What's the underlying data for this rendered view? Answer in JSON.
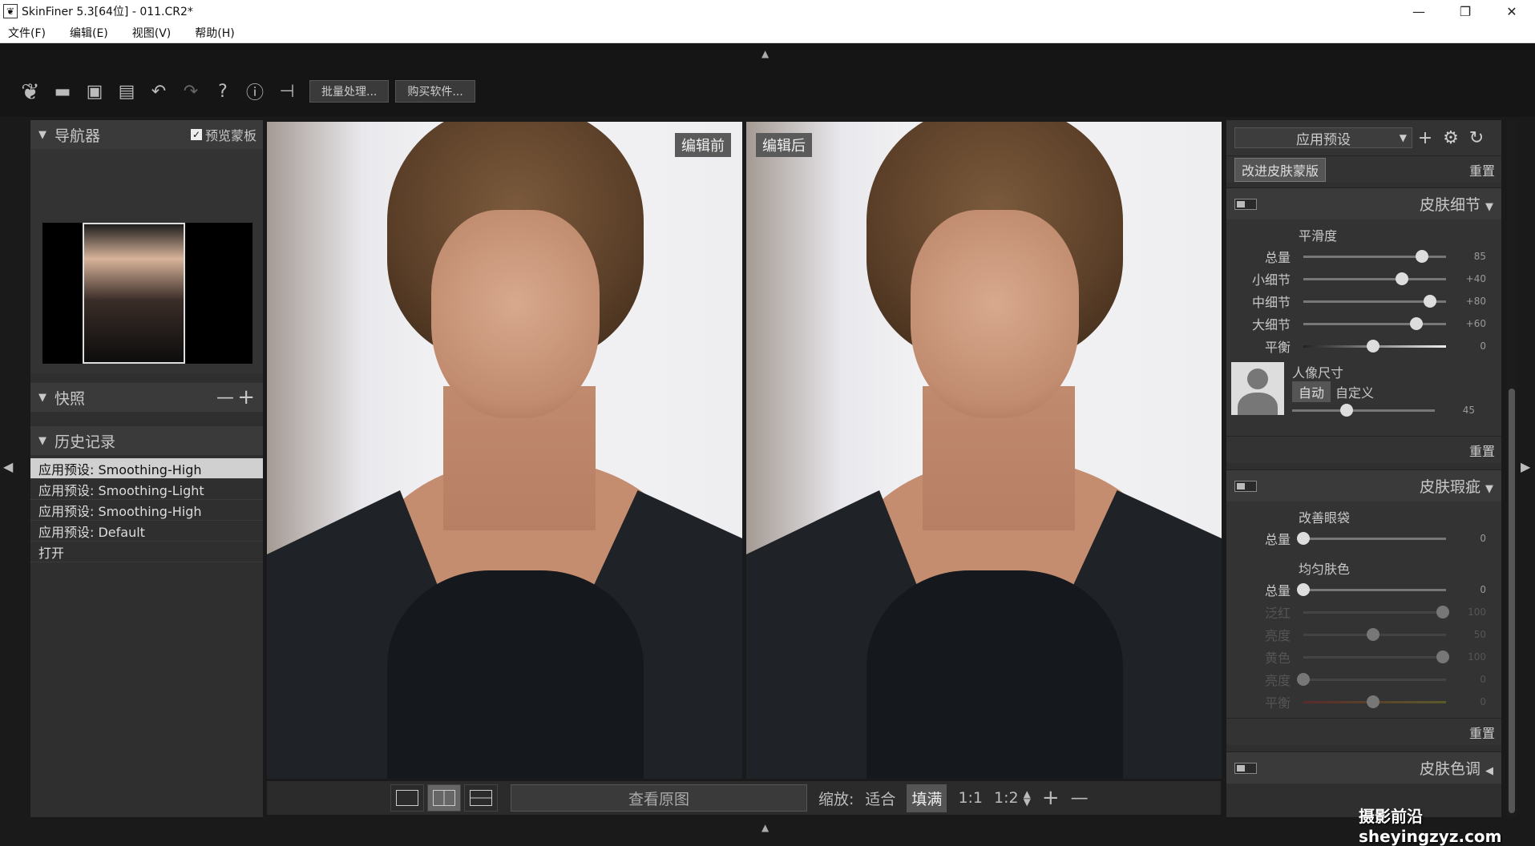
{
  "title_bar": {
    "title": "SkinFiner 5.3[64位] - 011.CR2*",
    "minimize": "—",
    "maximize": "❐",
    "close": "✕"
  },
  "menu": [
    "文件(F)",
    "编辑(E)",
    "视图(V)",
    "帮助(H)"
  ],
  "toolbar": {
    "batch_label": "批量处理...",
    "buy_label": "购买软件..."
  },
  "navigator": {
    "title": "导航器",
    "preview_mask_label": "预览蒙板",
    "preview_mask_checked": true
  },
  "snapshots": {
    "title": "快照",
    "remove": "—",
    "add": "+"
  },
  "history": {
    "title": "历史记录",
    "items": [
      "应用预设: Smoothing-High",
      "应用预设: Smoothing-Light",
      "应用预设: Smoothing-High",
      "应用预设: Default",
      "打开"
    ],
    "selected_index": 0
  },
  "panes": {
    "before_label": "编辑前",
    "after_label": "编辑后"
  },
  "bottom_bar": {
    "view_original": "查看原图",
    "zoom_label": "缩放:",
    "zoom_options": [
      "适合",
      "填满",
      "1:1",
      "1:2"
    ],
    "zoom_active": "填满",
    "zoom_in": "+",
    "zoom_out": "—"
  },
  "right_panel": {
    "preset_select": "应用预设",
    "improve_mask": "改进皮肤蒙版",
    "reset": "重置",
    "skin_detail": {
      "title": "皮肤细节",
      "smoothness_title": "平滑度",
      "sliders": [
        {
          "label": "总量",
          "value": "85",
          "pos": 0.83
        },
        {
          "label": "小细节",
          "value": "+40",
          "pos": 0.69
        },
        {
          "label": "中细节",
          "value": "+80",
          "pos": 0.89
        },
        {
          "label": "大细节",
          "value": "+60",
          "pos": 0.79
        },
        {
          "label": "平衡",
          "value": "0",
          "pos": 0.49
        }
      ],
      "portrait_size_title": "人像尺寸",
      "auto": "自动",
      "custom": "自定义",
      "portrait_value": "45",
      "portrait_pos": 0.38
    },
    "skin_blemish": {
      "title": "皮肤瑕疵",
      "eyebag_title": "改善眼袋",
      "eyebag_slider": {
        "label": "总量",
        "value": "0",
        "pos": 0.0
      },
      "even_tone_title": "均匀肤色",
      "even_tone_sliders": [
        {
          "label": "总量",
          "value": "0",
          "pos": 0.0,
          "dim": false
        },
        {
          "label": "泛红",
          "value": "100",
          "pos": 0.98,
          "dim": true
        },
        {
          "label": "亮度",
          "value": "50",
          "pos": 0.49,
          "dim": true
        },
        {
          "label": "黄色",
          "value": "100",
          "pos": 0.98,
          "dim": true
        },
        {
          "label": "亮度",
          "value": "0",
          "pos": 0.0,
          "dim": true
        },
        {
          "label": "平衡",
          "value": "0",
          "pos": 0.49,
          "dim": true
        }
      ]
    },
    "skin_tone": {
      "title": "皮肤色调"
    }
  },
  "watermark": "摄影前沿 sheyingzyz.com"
}
